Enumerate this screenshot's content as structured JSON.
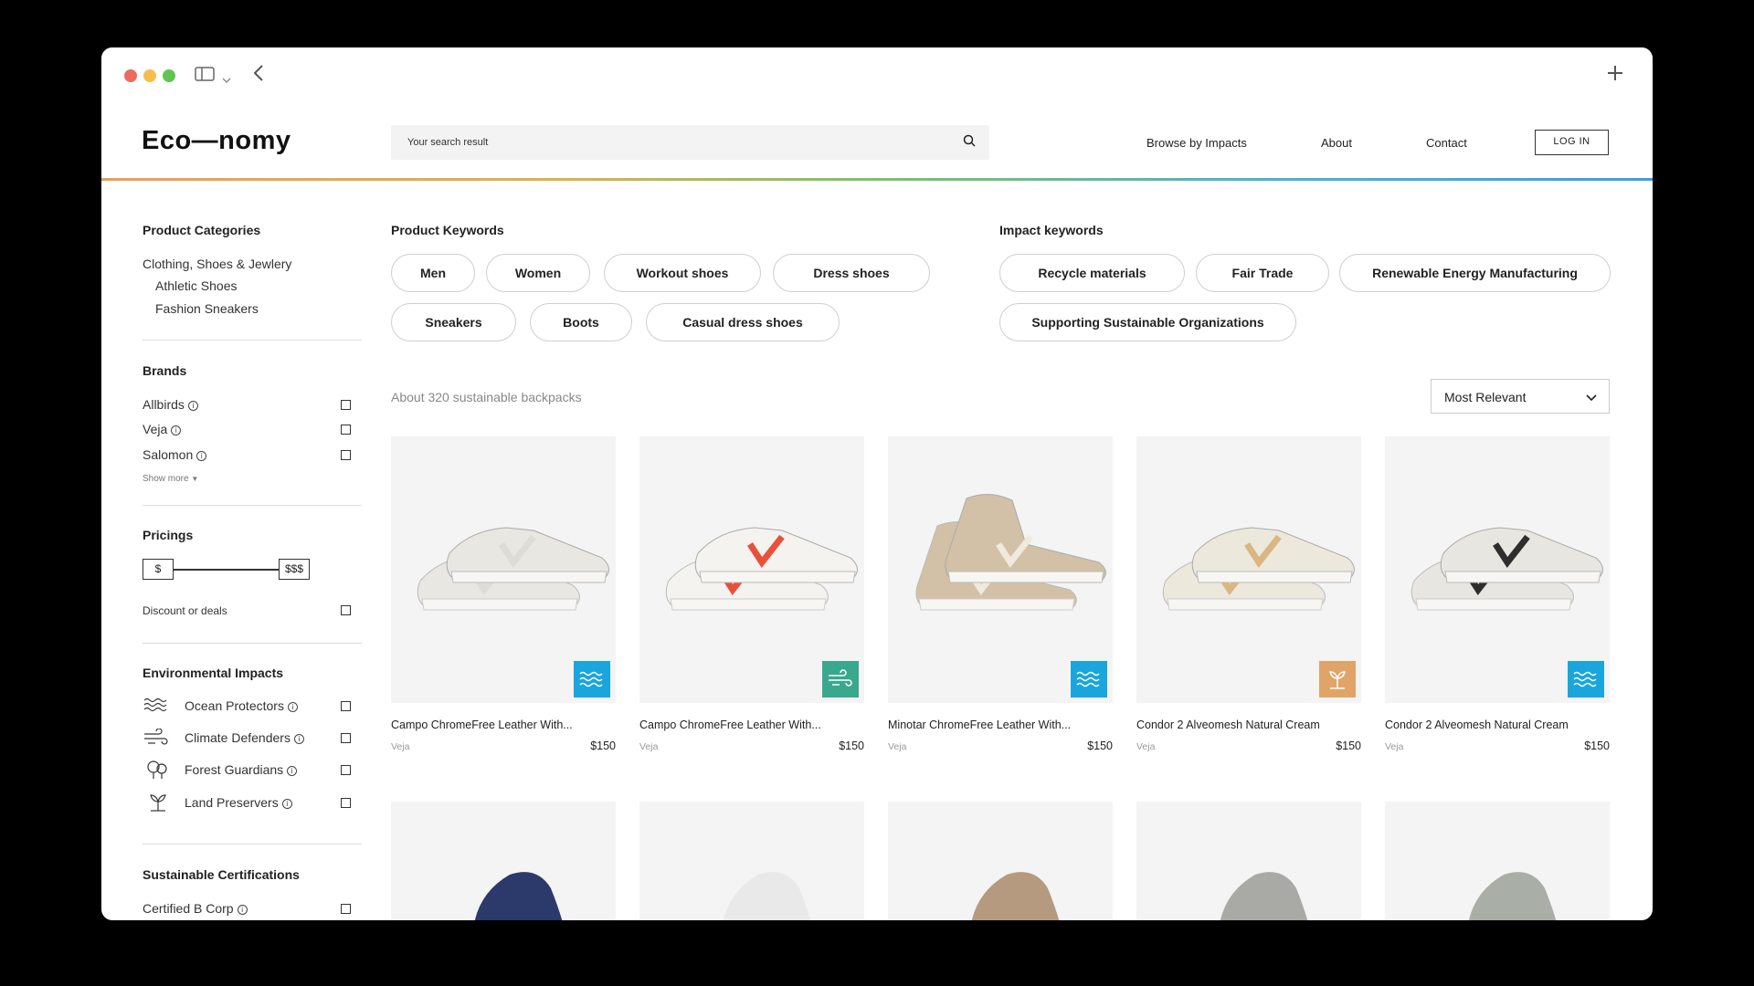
{
  "logo": "Eco—nomy",
  "search": {
    "placeholder": "Your search result"
  },
  "nav": {
    "browse": "Browse by Impacts",
    "about": "About",
    "contact": "Contact",
    "login": "LOG IN"
  },
  "sidebar": {
    "categories_title": "Product Categories",
    "categories": [
      "Clothing, Shoes & Jewlery",
      "Athletic Shoes",
      "Fashion Sneakers"
    ],
    "brands_title": "Brands",
    "brands": [
      "Allbirds",
      "Veja",
      "Salomon"
    ],
    "show_more": "Show more",
    "pricings_title": "Pricings",
    "price_min": "$",
    "price_max": "$$$",
    "discount": "Discount or deals",
    "impacts_title": "Environmental Impacts",
    "impacts": [
      {
        "label": "Ocean Protectors",
        "icon": "waves-icon"
      },
      {
        "label": "Climate Defenders",
        "icon": "wind-icon"
      },
      {
        "label": "Forest Guardians",
        "icon": "tree-icon"
      },
      {
        "label": "Land Preservers",
        "icon": "sprout-icon"
      }
    ],
    "certs_title": "Sustainable Certifications",
    "certs": [
      "Certified B Corp"
    ]
  },
  "product_keywords": {
    "title": "Product Keywords",
    "items": [
      "Men",
      "Women",
      "Workout shoes",
      "Dress shoes",
      "Sneakers",
      "Boots",
      "Casual dress shoes"
    ]
  },
  "impact_keywords": {
    "title": "Impact keywords",
    "items": [
      "Recycle materials",
      "Fair Trade",
      "Renewable Energy Manufacturing",
      "Supporting Sustainable Organizations"
    ]
  },
  "results": {
    "count": "About 320 sustainable backpacks",
    "sort": "Most Relevant"
  },
  "products": [
    {
      "name": "Campo ChromeFree Leather With...",
      "brand": "Veja",
      "price": "$150",
      "badge": "waves-icon",
      "badge_color": "#1aa6dc",
      "shoe_color": "#e8e7e2",
      "accent": "#dedcd6"
    },
    {
      "name": "Campo ChromeFree Leather With...",
      "brand": "Veja",
      "price": "$150",
      "badge": "wind-icon",
      "badge_color": "#3aa88c",
      "shoe_color": "#f4f3ef",
      "accent": "#e8503a"
    },
    {
      "name": "Minotar ChromeFree Leather With...",
      "brand": "Veja",
      "price": "$150",
      "badge": "waves-icon",
      "badge_color": "#1aa6dc",
      "shoe_color": "#d2c1a6",
      "accent": "#efe9de"
    },
    {
      "name": "Condor 2 Alveomesh Natural Cream",
      "brand": "Veja",
      "price": "$150",
      "badge": "sprout-icon",
      "badge_color": "#e0a468",
      "shoe_color": "#ece8dc",
      "accent": "#d9b682"
    },
    {
      "name": "Condor 2 Alveomesh Natural Cream",
      "brand": "Veja",
      "price": "$150",
      "badge": "waves-icon",
      "badge_color": "#1aa6dc",
      "shoe_color": "#e8e6e0",
      "accent": "#2e2e2e"
    }
  ],
  "row2_colors": [
    "#2b3a6b",
    "#e9e9e9",
    "#b59a80",
    "#a9aaa6",
    "#a9aea6"
  ]
}
